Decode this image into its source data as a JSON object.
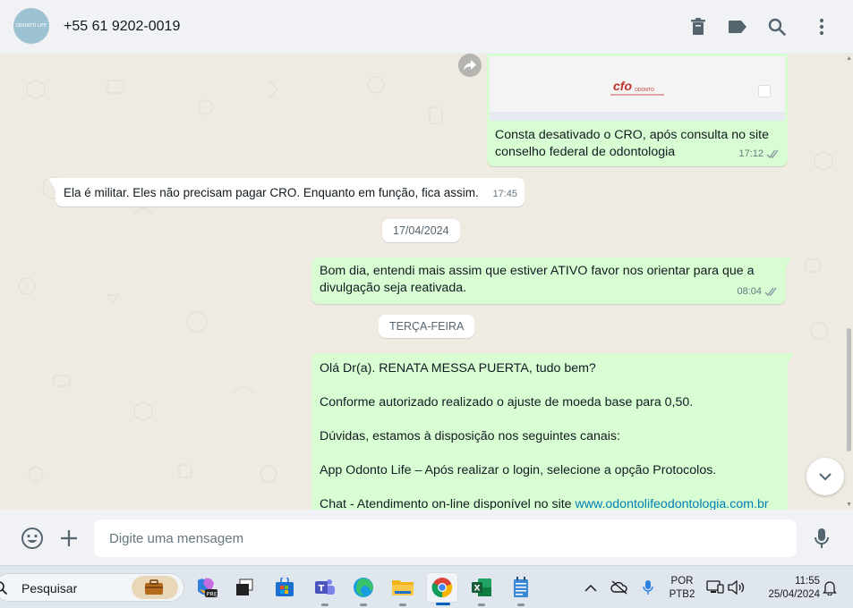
{
  "header": {
    "avatar_text": "ODONTO LIFE",
    "contact_name": "+55 61 9202-0019",
    "icons": [
      "delete-icon",
      "label-icon",
      "search-icon",
      "menu-icon"
    ]
  },
  "messages": {
    "image_caption": "Consta desativado o CRO, após consulta no site conselho federal de odontologia",
    "image_time": "17:12",
    "image_logo_text": "cfo",
    "image_logo_sub": "ODONTO",
    "ela_text": "Ela é  militar. Eles não precisam pagar CRO. Enquanto em função, fica assim.",
    "ela_time": "17:45",
    "date_chip_1": "17/04/2024",
    "bom_text": "Bom dia, entendi mais assim que estiver ATIVO favor nos orientar para que a divulgação seja reativada.",
    "bom_time": "08:04",
    "date_chip_2": "TERÇA-FEIRA",
    "ola_line1": "Olá Dr(a). RENATA MESSA PUERTA, tudo bem?",
    "ola_line2": "Conforme autorizado realizado o ajuste de moeda base para 0,50.",
    "ola_line3": "Dúvidas, estamos à disposição nos seguintes canais:",
    "ola_line4": "App Odonto Life – Após realizar o login, selecione a opção Protocolos.",
    "ola_line5_prefix": "Chat - Atendimento on-line disponível no site ",
    "ola_link": "www.odontolifeodontologia.com.br"
  },
  "composer": {
    "placeholder": "Digite uma mensagem",
    "icons": [
      "emoji-icon",
      "plus-icon",
      "microphone-icon"
    ]
  },
  "taskbar": {
    "search_placeholder": "Pesquisar",
    "apps": [
      "briefcase-icon",
      "copilot-icon",
      "task-view-icon",
      "store-icon",
      "teams-icon",
      "edge-icon",
      "file-explorer-icon",
      "chrome-icon",
      "excel-icon",
      "notepad-icon"
    ],
    "language_line1": "POR",
    "language_line2": "PTB2",
    "time": "11:55",
    "date": "25/04/2024"
  },
  "colors": {
    "outgoing_bubble": "#d9fdd3",
    "incoming_bubble": "#ffffff",
    "chat_bg": "#efeae2",
    "read_ticks": "#53bdeb",
    "link": "#027eb5"
  }
}
